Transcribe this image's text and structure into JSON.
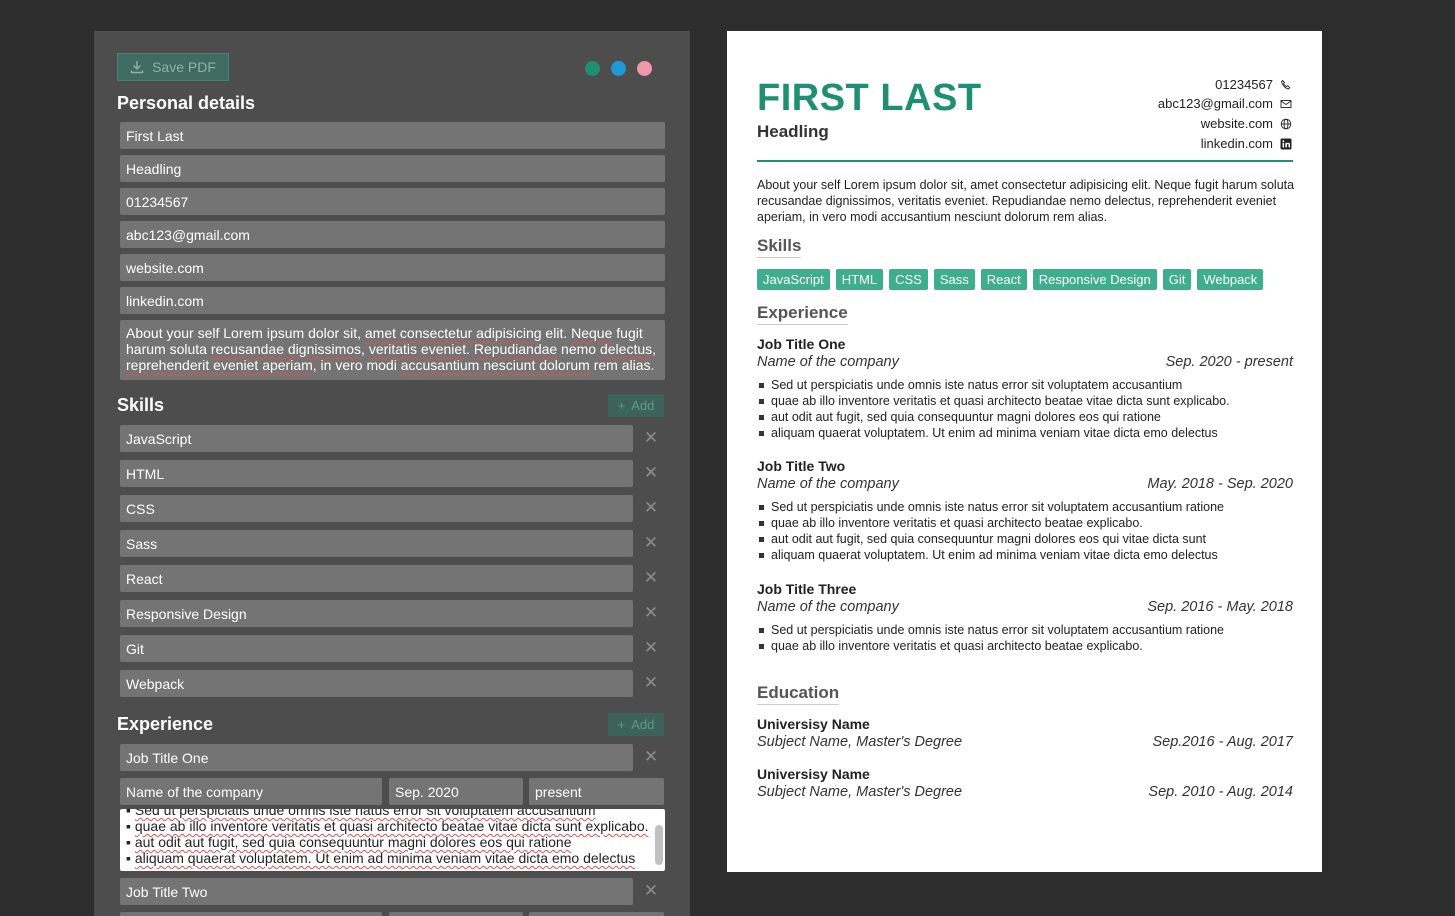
{
  "editor": {
    "save_label": "Save PDF",
    "personal_title": "Personal details",
    "fields": {
      "name": "First Last",
      "headline": "Headling",
      "phone": "01234567",
      "email": "abc123@gmail.com",
      "website": "website.com",
      "linkedin": "linkedin.com"
    },
    "about_lines": [
      [
        "About your self Lorem ipsum dolor sit, ",
        "amet consectetur adipisicing",
        " elit. ",
        "Neque",
        " fugit"
      ],
      [
        "harum soluta ",
        "recusandae dignissimos",
        ", ",
        "veritatis eveniet",
        ". ",
        "Repudiandae",
        " nemo ",
        "delectus",
        ","
      ],
      [
        "reprehenderit eveniet aperiam",
        ", in vero modi ",
        "accusantium nesciunt dolorum",
        " rem alias."
      ]
    ],
    "skills_title": "Skills",
    "add_label": "Add",
    "skills": [
      "JavaScript",
      "HTML",
      "CSS",
      "Sass",
      "React",
      "Responsive Design",
      "Git",
      "Webpack"
    ],
    "experience_title": "Experience",
    "job1": {
      "title": "Job Title One",
      "company": "Name of the company",
      "start": "Sep. 2020",
      "end": "present"
    },
    "desc_lines": [
      "Sed ut perspiciatis unde omnis iste natus error sit voluptatem accusantium",
      "quae ab illo inventore veritatis et quasi architecto beatae vitae dicta sunt explicabo.",
      "aut odit aut fugit, sed quia consequuntur magni dolores eos qui ratione",
      "aliquam quaerat voluptatem. Ut enim ad minima veniam  vitae dicta emo delectus"
    ],
    "job2_title": "Job Title Two"
  },
  "colors": {
    "green": "#1e8f72",
    "blue": "#1f98d8",
    "pink": "#ee98ab",
    "chip": "#3fae8e"
  },
  "resume": {
    "name": "FIRST LAST",
    "headline": "Headling",
    "phone": "01234567",
    "email": "abc123@gmail.com",
    "website": "website.com",
    "linkedin": "linkedin.com",
    "about": "About your self Lorem ipsum dolor sit, amet consectetur adipisicing elit. Neque fugit harum soluta recusandae dignissimos, veritatis eveniet. Repudiandae nemo delectus, reprehenderit eveniet aperiam, in vero modi accusantium nesciunt dolorum rem alias.",
    "skills_title": "Skills",
    "skills": [
      "JavaScript",
      "HTML",
      "CSS",
      "Sass",
      "React",
      "Responsive Design",
      "Git",
      "Webpack"
    ],
    "experience_title": "Experience",
    "jobs": [
      {
        "title": "Job Title One",
        "company": "Name of the company",
        "dates": "Sep. 2020 - present",
        "bullets": [
          "Sed ut perspiciatis unde omnis iste natus error sit voluptatem accusantium",
          "quae ab illo inventore veritatis et quasi architecto beatae vitae dicta sunt explicabo.",
          "aut odit aut fugit, sed quia consequuntur magni dolores eos qui ratione",
          "aliquam quaerat voluptatem. Ut enim ad minima veniam  vitae dicta emo delectus"
        ]
      },
      {
        "title": "Job Title Two",
        "company": "Name of the company",
        "dates": "May. 2018 - Sep. 2020",
        "bullets": [
          "Sed ut perspiciatis unde omnis iste natus error sit voluptatem accusantium ratione",
          "quae ab illo inventore veritatis et quasi architecto beatae  explicabo.",
          "aut odit aut fugit, sed quia consequuntur magni dolores eos qui  vitae dicta sunt",
          "aliquam quaerat voluptatem. Ut enim ad minima veniam  vitae dicta emo delectus"
        ]
      },
      {
        "title": "Job Title Three",
        "company": "Name of the company",
        "dates": "Sep. 2016 - May. 2018",
        "bullets": [
          "Sed ut perspiciatis unde omnis iste natus error sit voluptatem accusantium ratione",
          "quae ab illo inventore veritatis et quasi architecto beatae  explicabo."
        ]
      }
    ],
    "education_title": "Education",
    "education": [
      {
        "school": "Universisy Name",
        "degree": "Subject Name, Master's Degree",
        "dates": "Sep.2016 - Aug. 2017"
      },
      {
        "school": "Universisy Name",
        "degree": "Subject Name, Master's Degree",
        "dates": "Sep. 2010 - Aug. 2014"
      }
    ]
  }
}
